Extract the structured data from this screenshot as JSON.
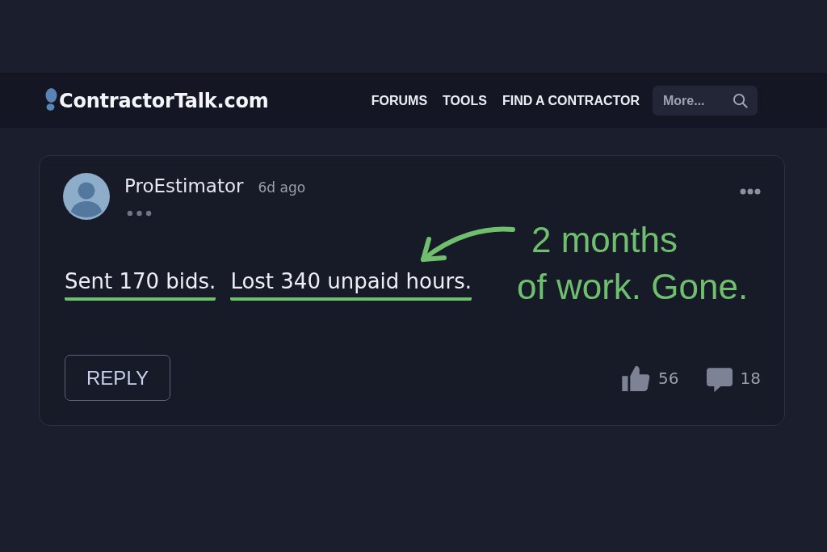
{
  "header": {
    "logo": "ContractorTalk.com",
    "nav": [
      "FORUMS",
      "TOOLS",
      "FIND A CONTRACTOR"
    ],
    "search": {
      "placeholder": "More..."
    }
  },
  "post": {
    "author": "ProEstimator",
    "time": "6d ago",
    "sentences": [
      {
        "text": "Sent 170 bids.",
        "underlined": true
      },
      {
        "text": "Lost 340 unpaid hours.",
        "underlined": true
      }
    ],
    "annotation": "2 months\nof work. Gone.",
    "reply_label": "REPLY",
    "likes": "56",
    "comments": "18"
  }
}
